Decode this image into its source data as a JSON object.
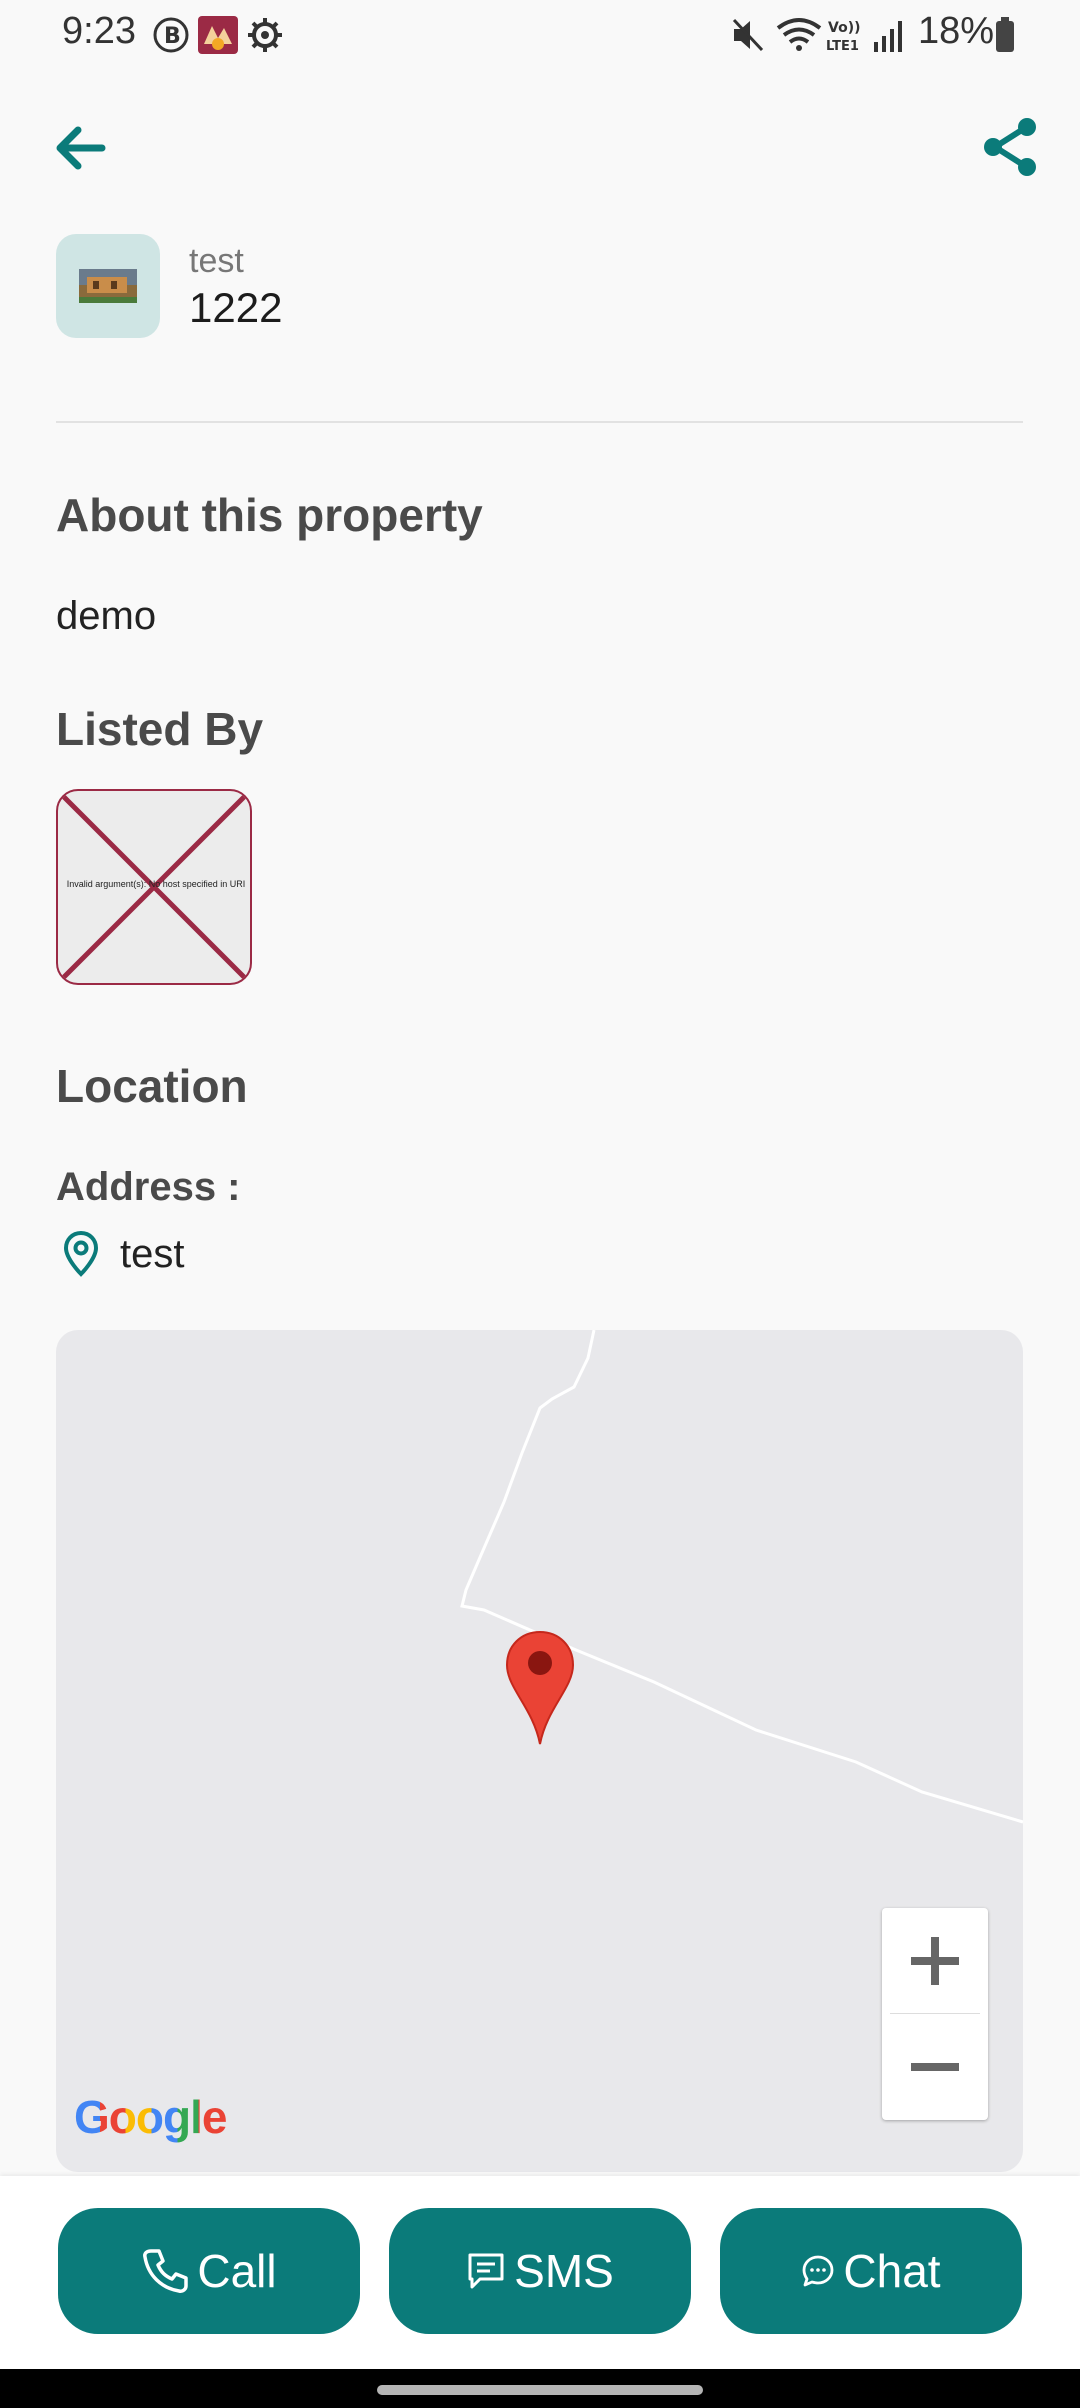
{
  "status_bar": {
    "time": "9:23",
    "battery": "18%",
    "icons": [
      "b-circle-icon",
      "app-icon",
      "settings-gear-icon",
      "mute-icon",
      "wifi-icon",
      "volte-icon",
      "signal-icon",
      "battery-icon"
    ]
  },
  "header": {
    "property_name": "test",
    "property_price": "1222"
  },
  "about": {
    "title": "About this property",
    "description": "demo"
  },
  "listed_by": {
    "title": "Listed By",
    "image_error": "Invalid argument(s): No host specified in URI"
  },
  "location": {
    "title": "Location",
    "address_label": "Address :",
    "address_value": "test",
    "map_logo": "Google"
  },
  "actions": {
    "call": "Call",
    "sms": "SMS",
    "chat": "Chat"
  },
  "colors": {
    "accent": "#0b7b7a",
    "map_background": "#e8e8eb",
    "marker": "#ea4335"
  }
}
